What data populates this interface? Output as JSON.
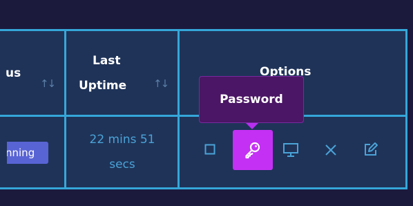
{
  "table": {
    "headers": {
      "status_partial": "us",
      "last_uptime_line1": "Last",
      "last_uptime_line2": "Uptime",
      "options": "Options",
      "sort_glyph": "↑↓"
    },
    "row": {
      "status_pill": "nning",
      "uptime_line1": "22 mins 51",
      "uptime_line2": "secs"
    },
    "actions": {
      "tooltip": "Password",
      "icons": [
        "stop-icon",
        "key-icon",
        "monitor-icon",
        "close-icon",
        "edit-icon"
      ]
    }
  },
  "colors": {
    "grid": "#35a7d9",
    "cell_bg": "#1f3358",
    "page_bg": "#1b1a3d",
    "accent": "#c430f4",
    "pill": "#5964d4",
    "uptime_text": "#4aa3d8"
  }
}
